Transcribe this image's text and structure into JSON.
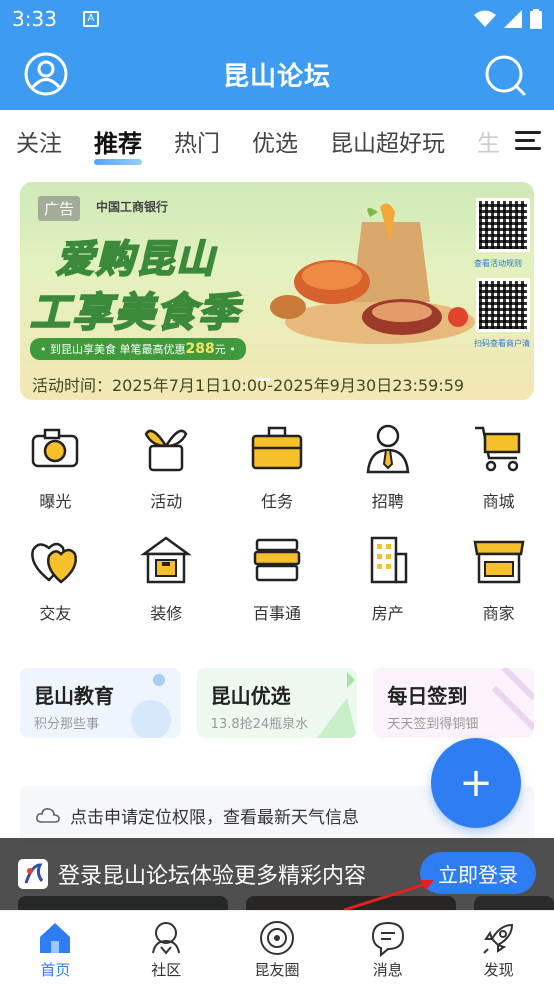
{
  "status_bar": {
    "time": "3:33",
    "notif_glyph": "A"
  },
  "header": {
    "title": "昆山论坛"
  },
  "tabs": [
    {
      "label": "关注"
    },
    {
      "label": "推荐"
    },
    {
      "label": "热门"
    },
    {
      "label": "优选"
    },
    {
      "label": "昆山超好玩"
    },
    {
      "label": "生"
    }
  ],
  "banner": {
    "ad_tag": "广告",
    "bank": "中国工商银行",
    "headline_1": "爱购昆山",
    "headline_2": "工享美食季",
    "promo_prefix": "• 到昆山享美食 单笔最高优惠",
    "promo_amount": "288",
    "promo_suffix": "元 •",
    "period": "活动时间：2025年7月1日10:00-2025年9月30日23:59:59",
    "qr_label_1": "查看活动规则",
    "qr_label_2": "扫码查看商户清"
  },
  "grid": [
    {
      "label": "曝光",
      "icon": "camera-icon"
    },
    {
      "label": "活动",
      "icon": "sprout-tv-icon"
    },
    {
      "label": "任务",
      "icon": "briefcase-icon"
    },
    {
      "label": "招聘",
      "icon": "person-tie-icon"
    },
    {
      "label": "商城",
      "icon": "cart-icon"
    },
    {
      "label": "交友",
      "icon": "hearts-icon"
    },
    {
      "label": "装修",
      "icon": "house-hammer-icon"
    },
    {
      "label": "百事通",
      "icon": "books-icon"
    },
    {
      "label": "房产",
      "icon": "building-icon"
    },
    {
      "label": "商家",
      "icon": "shop-icon"
    }
  ],
  "cards": [
    {
      "title": "昆山教育",
      "sub": "积分那些事"
    },
    {
      "title": "昆山优选",
      "sub": "13.8抢24瓶泉水"
    },
    {
      "title": "每日签到",
      "sub": "天天签到得铜钿"
    }
  ],
  "fab": {
    "label": "+"
  },
  "weather": {
    "text": "点击申请定位权限，查看最新天气信息"
  },
  "login_bar": {
    "message": "登录昆山论坛体验更多精彩内容",
    "button": "立即登录"
  },
  "bottom_nav": [
    {
      "label": "首页",
      "icon": "home-icon"
    },
    {
      "label": "社区",
      "icon": "community-icon"
    },
    {
      "label": "昆友圈",
      "icon": "circle-icon"
    },
    {
      "label": "消息",
      "icon": "message-icon"
    },
    {
      "label": "发现",
      "icon": "rocket-icon"
    }
  ],
  "colors": {
    "brand": "#3d9cf2",
    "accent": "#2f7df3",
    "icon_yellow": "#f5c02a"
  }
}
